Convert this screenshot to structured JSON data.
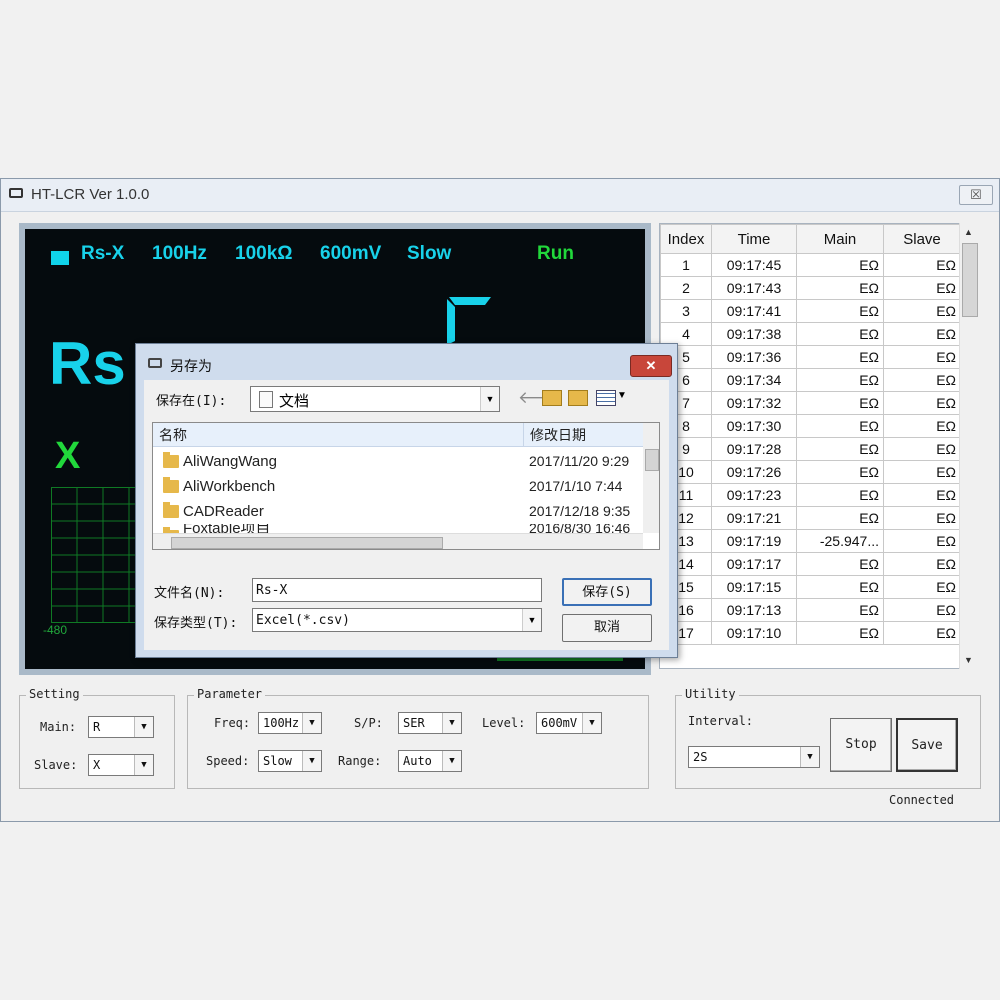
{
  "app": {
    "title": "HT-LCR Ver 1.0.0",
    "close_symbol": "☒"
  },
  "display": {
    "mode": "Rs-X",
    "freq": "100Hz",
    "range": "100kΩ",
    "level": "600mV",
    "speed": "Slow",
    "state": "Run",
    "main_label": "Rs",
    "slave_label": "X",
    "axis_min": "-480",
    "colors": {
      "cyan": "#18d2ea",
      "green": "#21d83b",
      "bg": "#050b0e"
    }
  },
  "table": {
    "headers": [
      "Index",
      "Time",
      "Main",
      "Slave"
    ],
    "rows": [
      [
        "1",
        "09:17:45",
        "EΩ",
        "EΩ"
      ],
      [
        "2",
        "09:17:43",
        "EΩ",
        "EΩ"
      ],
      [
        "3",
        "09:17:41",
        "EΩ",
        "EΩ"
      ],
      [
        "4",
        "09:17:38",
        "EΩ",
        "EΩ"
      ],
      [
        "5",
        "09:17:36",
        "EΩ",
        "EΩ"
      ],
      [
        "6",
        "09:17:34",
        "EΩ",
        "EΩ"
      ],
      [
        "7",
        "09:17:32",
        "EΩ",
        "EΩ"
      ],
      [
        "8",
        "09:17:30",
        "EΩ",
        "EΩ"
      ],
      [
        "9",
        "09:17:28",
        "EΩ",
        "EΩ"
      ],
      [
        "10",
        "09:17:26",
        "EΩ",
        "EΩ"
      ],
      [
        "11",
        "09:17:23",
        "EΩ",
        "EΩ"
      ],
      [
        "12",
        "09:17:21",
        "EΩ",
        "EΩ"
      ],
      [
        "13",
        "09:17:19",
        "-25.947...",
        "EΩ"
      ],
      [
        "14",
        "09:17:17",
        "EΩ",
        "EΩ"
      ],
      [
        "15",
        "09:17:15",
        "EΩ",
        "EΩ"
      ],
      [
        "16",
        "09:17:13",
        "EΩ",
        "EΩ"
      ],
      [
        "17",
        "09:17:10",
        "EΩ",
        "EΩ"
      ]
    ]
  },
  "setting": {
    "title": "Setting",
    "main_label": "Main:",
    "main_value": "R",
    "slave_label": "Slave:",
    "slave_value": "X"
  },
  "parameter": {
    "title": "Parameter",
    "freq_label": "Freq:",
    "freq_value": "100Hz",
    "sp_label": "S/P:",
    "sp_value": "SER",
    "level_label": "Level:",
    "level_value": "600mV",
    "speed_label": "Speed:",
    "speed_value": "Slow",
    "range_label": "Range:",
    "range_value": "Auto"
  },
  "utility": {
    "title": "Utility",
    "interval_label": "Interval:",
    "interval_value": "2S",
    "stop_label": "Stop",
    "save_label": "Save"
  },
  "status": "Connected",
  "dialog": {
    "title": "另存为",
    "close_symbol": "✕",
    "save_in_label": "保存在(I):",
    "save_in_value": "文档",
    "col_name": "名称",
    "col_date": "修改日期",
    "files": [
      {
        "name": "AliWangWang",
        "date": "2017/11/20 9:29"
      },
      {
        "name": "AliWorkbench",
        "date": "2017/1/10 7:44"
      },
      {
        "name": "CADReader",
        "date": "2017/12/18 9:35"
      },
      {
        "name": "Foxtable项目",
        "date": "2016/8/30 16:46"
      }
    ],
    "filename_label": "文件名(N):",
    "filename_value": "Rs-X",
    "filetype_label": "保存类型(T):",
    "filetype_value": "Excel(*.csv)",
    "save_button": "保存(S)",
    "cancel_button": "取消"
  }
}
